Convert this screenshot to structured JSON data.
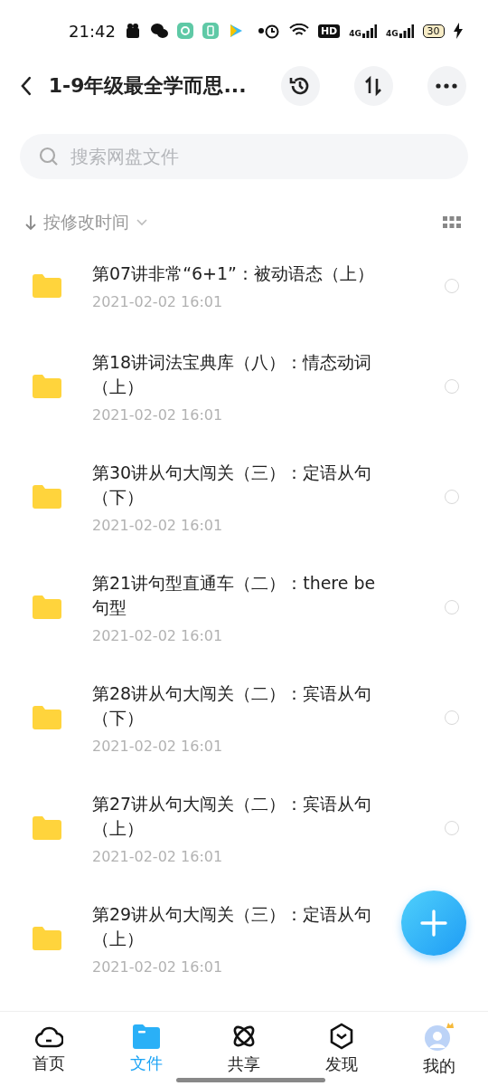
{
  "status_bar": {
    "time": "21:42",
    "hd_label": "HD",
    "signal_labels": [
      "4G",
      "4G"
    ],
    "battery": "30"
  },
  "header": {
    "title": "1-9年级最全学而思..."
  },
  "search": {
    "placeholder": "搜索网盘文件"
  },
  "sort": {
    "label": "按修改时间"
  },
  "files": [
    {
      "name": "第07讲非常“6+1”：被动语态（上）",
      "date": "2021-02-02  16:01",
      "selected": false
    },
    {
      "name": "第18讲词法宝典库（八）：情态动词（上）",
      "date": "2021-02-02  16:01",
      "selected": false
    },
    {
      "name": "第30讲从句大闯关（三）：定语从句（下）",
      "date": "2021-02-02  16:01",
      "selected": false
    },
    {
      "name": "第21讲句型直通车（二）：there be 句型",
      "date": "2021-02-02  16:01",
      "selected": false
    },
    {
      "name": "第28讲从句大闯关（二）：宾语从句（下）",
      "date": "2021-02-02  16:01",
      "selected": false
    },
    {
      "name": "第27讲从句大闯关（二）：宾语从句（上）",
      "date": "2021-02-02  16:01",
      "selected": false
    },
    {
      "name": "第29讲从句大闯关（三）：定语从句（上）",
      "date": "2021-02-02  16:01"
    }
  ],
  "nav": [
    {
      "kind": "home",
      "label": "首页",
      "selected": false
    },
    {
      "kind": "files",
      "label": "文件",
      "selected": true
    },
    {
      "kind": "share",
      "label": "共享",
      "selected": false
    },
    {
      "kind": "discover",
      "label": "发现",
      "selected": false
    },
    {
      "kind": "me",
      "label": "我的",
      "selected": false
    }
  ]
}
